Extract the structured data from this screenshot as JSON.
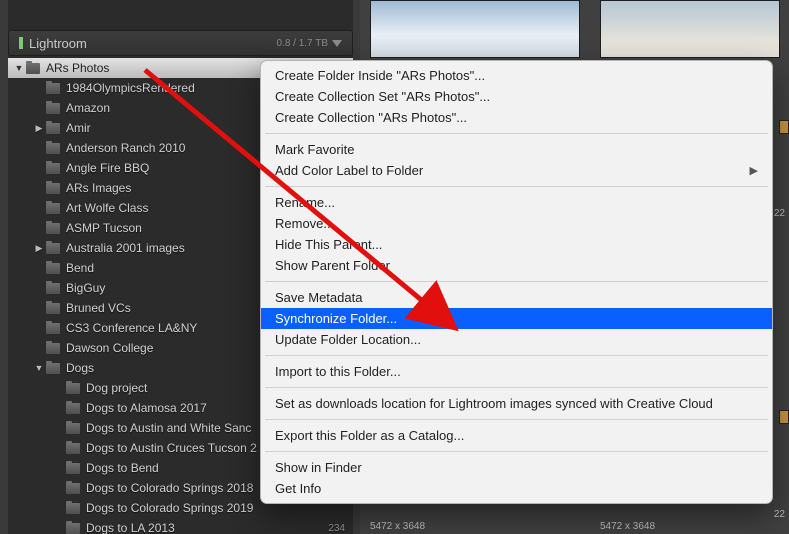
{
  "panel": {
    "title": "Lightroom",
    "storage": "0.8 / 1.7 TB"
  },
  "tree": [
    {
      "label": "ARs Photos",
      "depth": 0,
      "disc": "down",
      "selected": true
    },
    {
      "label": "1984OlympicsRendered",
      "depth": 1
    },
    {
      "label": "Amazon",
      "depth": 1
    },
    {
      "label": "Amir",
      "depth": 1,
      "disc": "right"
    },
    {
      "label": "Anderson Ranch 2010",
      "depth": 1
    },
    {
      "label": "Angle Fire BBQ",
      "depth": 1
    },
    {
      "label": "ARs Images",
      "depth": 1
    },
    {
      "label": "Art Wolfe Class",
      "depth": 1
    },
    {
      "label": "ASMP Tucson",
      "depth": 1
    },
    {
      "label": "Australia 2001 images",
      "depth": 1,
      "disc": "right"
    },
    {
      "label": "Bend",
      "depth": 1
    },
    {
      "label": "BigGuy",
      "depth": 1
    },
    {
      "label": "Bruned VCs",
      "depth": 1
    },
    {
      "label": "CS3 Conference LA&NY",
      "depth": 1
    },
    {
      "label": "Dawson College",
      "depth": 1
    },
    {
      "label": "Dogs",
      "depth": 1,
      "disc": "down"
    },
    {
      "label": "Dog project",
      "depth": 2
    },
    {
      "label": "Dogs to Alamosa 2017",
      "depth": 2
    },
    {
      "label": "Dogs to Austin and White Sanc",
      "depth": 2
    },
    {
      "label": "Dogs to Austin Cruces Tucson 2",
      "depth": 2
    },
    {
      "label": "Dogs to Bend",
      "depth": 2
    },
    {
      "label": "Dogs to Colorado Springs 2018",
      "depth": 2
    },
    {
      "label": "Dogs to Colorado Springs 2019",
      "depth": 2
    },
    {
      "label": "Dogs to LA 2013",
      "depth": 2,
      "count": "234"
    }
  ],
  "menu": {
    "groups": [
      [
        {
          "label": "Create Folder Inside \"ARs Photos\"..."
        },
        {
          "label": "Create Collection Set \"ARs Photos\"..."
        },
        {
          "label": "Create Collection \"ARs Photos\"..."
        }
      ],
      [
        {
          "label": "Mark Favorite"
        },
        {
          "label": "Add Color Label to Folder",
          "submenu": true
        }
      ],
      [
        {
          "label": "Rename..."
        },
        {
          "label": "Remove..."
        },
        {
          "label": "Hide This Parent..."
        },
        {
          "label": "Show Parent Folder"
        }
      ],
      [
        {
          "label": "Save Metadata"
        },
        {
          "label": "Synchronize Folder...",
          "highlight": true
        },
        {
          "label": "Update Folder Location..."
        }
      ],
      [
        {
          "label": "Import to this Folder..."
        }
      ],
      [
        {
          "label": "Set as downloads location for Lightroom images synced with Creative Cloud"
        }
      ],
      [
        {
          "label": "Export this Folder as a Catalog..."
        }
      ],
      [
        {
          "label": "Show in Finder"
        },
        {
          "label": "Get Info"
        }
      ]
    ]
  },
  "thumbs": {
    "dim1": "5472 x 3648",
    "dim2": "5472 x 3648",
    "badge22a": "22",
    "badge22b": "22"
  }
}
